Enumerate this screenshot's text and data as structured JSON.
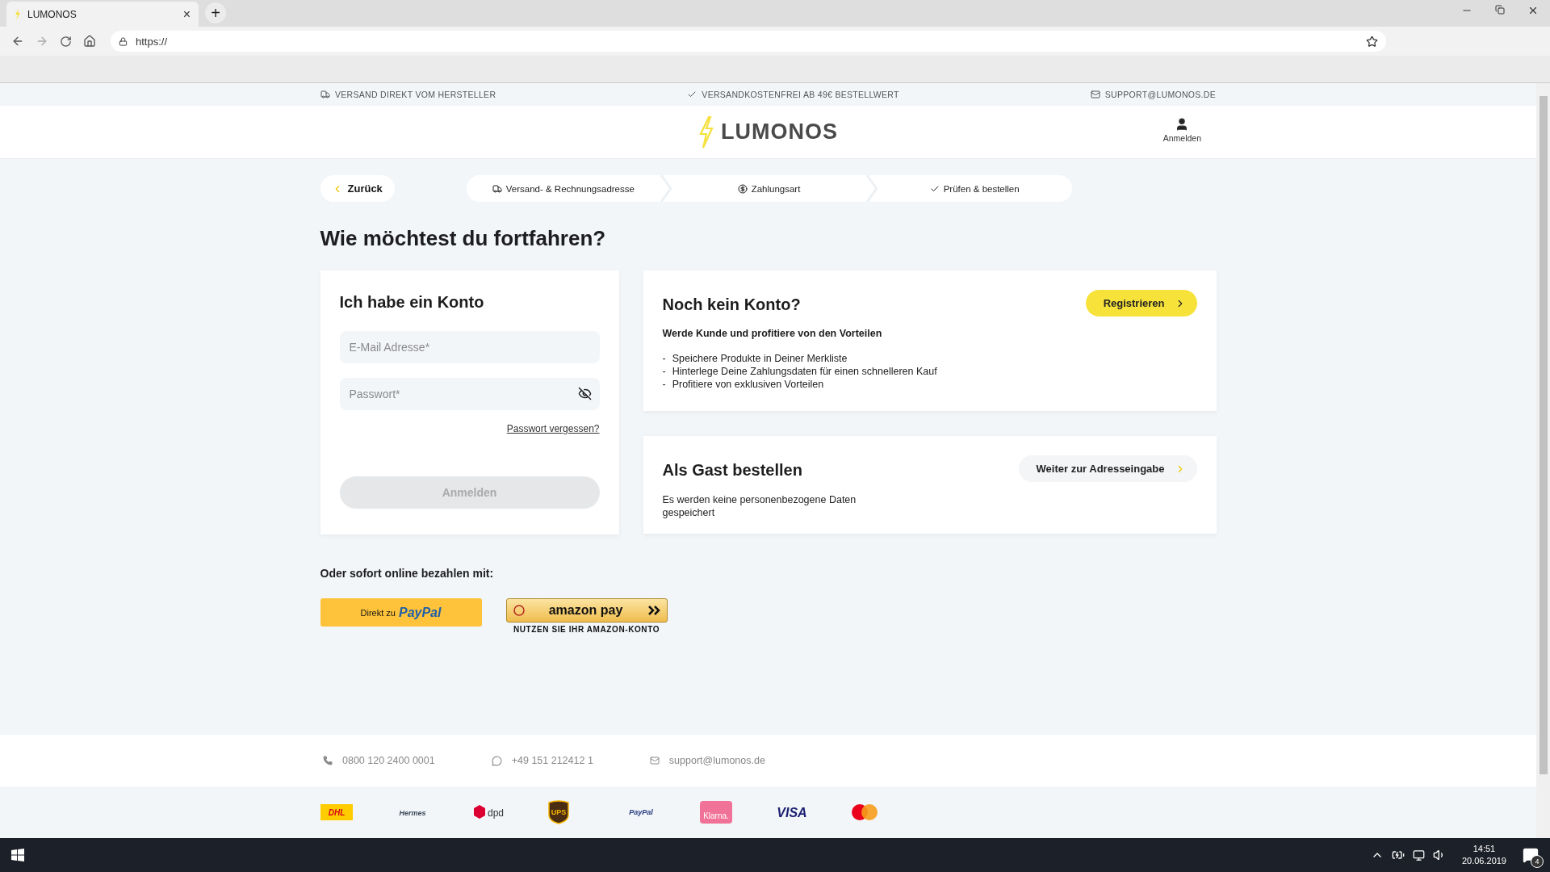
{
  "browser": {
    "tab_title": "LUMONOS",
    "tab_close": "×",
    "new_tab": "+",
    "url": "https://"
  },
  "topbar": [
    {
      "kind": "truck",
      "text": "VERSAND DIREKT VOM HERSTELLER"
    },
    {
      "kind": "check",
      "text": "VERSANDKOSTENFREI AB 49€ BESTELLWERT"
    },
    {
      "kind": "mail",
      "text": "SUPPORT@LUMONOS.DE"
    }
  ],
  "header": {
    "logo": "LUMONOS",
    "account": "Anmelden"
  },
  "back": "Zurück",
  "steps": [
    {
      "kind": "truck",
      "label": "Versand- & Rechnungsadresse"
    },
    {
      "kind": "coin",
      "label": "Zahlungsart"
    },
    {
      "kind": "check",
      "label": "Prüfen & bestellen"
    }
  ],
  "heading": "Wie möchtest du fortfahren?",
  "login": {
    "title": "Ich habe ein Konto",
    "email_placeholder": "E-Mail Adresse*",
    "password_placeholder": "Passwort*",
    "forgot": "Passwort vergessen?",
    "submit": "Anmelden",
    "submit_disabled": true
  },
  "register": {
    "title": "Noch kein Konto?",
    "button": "Registrieren",
    "subtitle": "Werde Kunde und profitiere von den Vorteilen",
    "benefits": [
      {
        "marker": "-",
        "text": "Speichere Produkte in Deiner Merkliste"
      },
      {
        "marker": "-",
        "text": "Hinterlege Deine Zahlungsdaten für einen schnelleren Kauf"
      },
      {
        "marker": "-",
        "text": "Profitiere von exklusiven Vorteilen"
      }
    ]
  },
  "guest": {
    "title": "Als Gast bestellen",
    "button": "Weiter zur Adresseingabe",
    "text": "Es werden keine personenbezogene Daten gespeichert"
  },
  "instant": {
    "title": "Oder sofort online bezahlen mit:",
    "paypal_prefix": "Direkt zu",
    "paypal_brand": "PayPal",
    "amazon_brand": "amazon pay",
    "amazon_caption": "NUTZEN SIE IHR AMAZON-KONTO"
  },
  "contacts": [
    {
      "kind": "phone",
      "text": "0800 120 2400 0001"
    },
    {
      "kind": "whatsapp",
      "text": "+49 151 212412 1"
    },
    {
      "kind": "mail",
      "text": "support@lumonos.de"
    }
  ],
  "logos": [
    {
      "kind": "dhl",
      "text": "DHL"
    },
    {
      "kind": "hermes",
      "text": "Hermes"
    },
    {
      "kind": "dpd",
      "text": "dpd"
    },
    {
      "kind": "ups",
      "text": "UPS"
    },
    {
      "kind": "paypal",
      "text": "PayPal"
    },
    {
      "kind": "klarna",
      "text": "Klarna."
    },
    {
      "kind": "visa",
      "text": "VISA"
    },
    {
      "kind": "mastercard"
    }
  ],
  "taskbar": {
    "time": "14:51",
    "date": "20.06.2019",
    "notifications": "4"
  }
}
